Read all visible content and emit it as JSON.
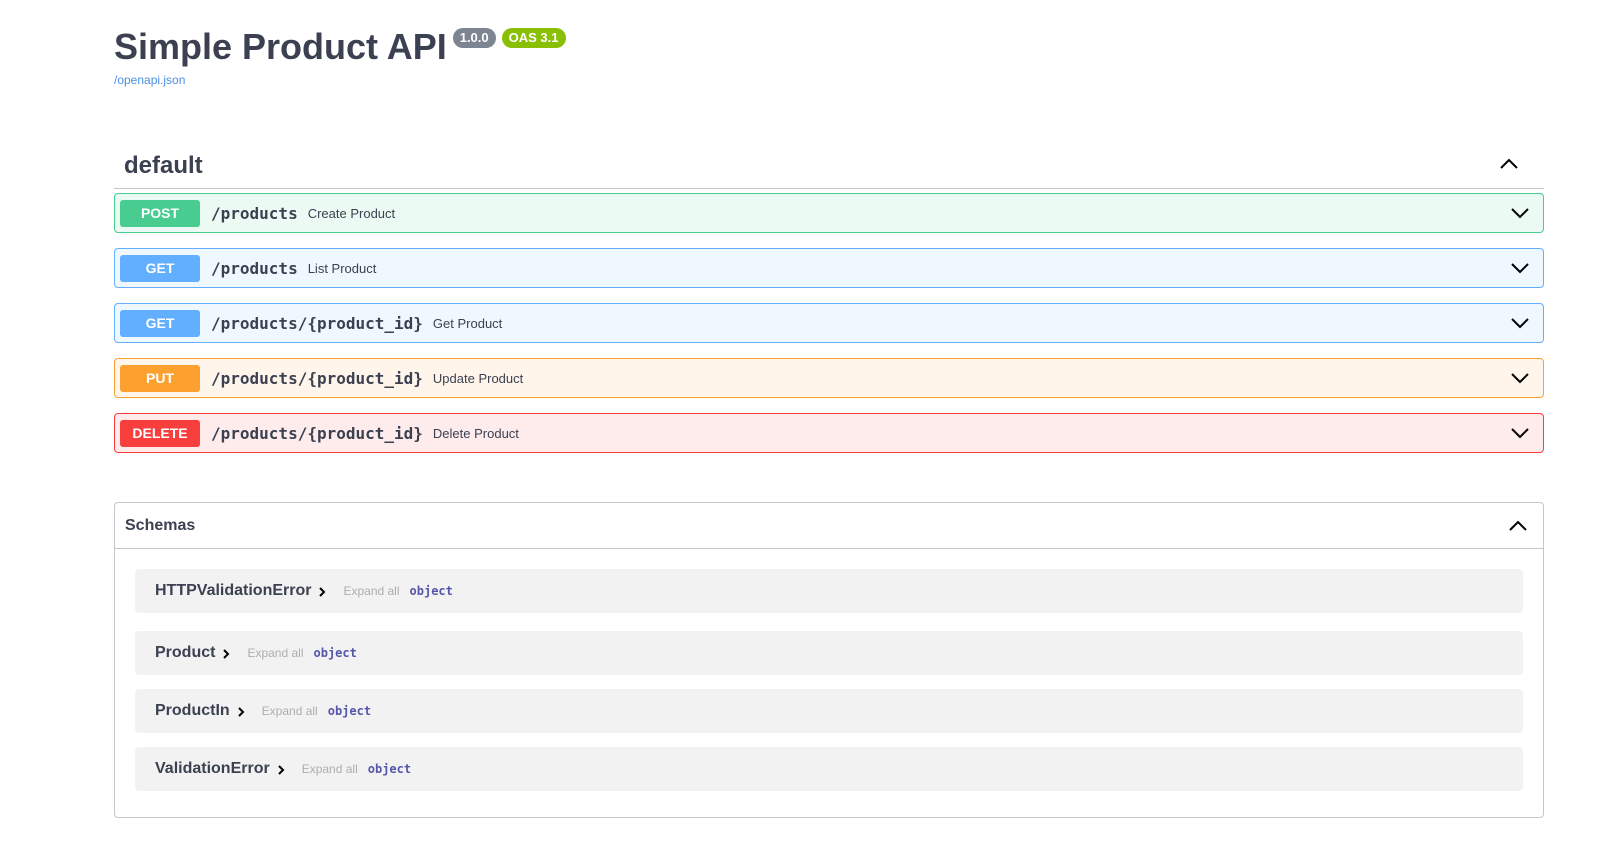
{
  "info": {
    "title": "Simple Product API",
    "version": "1.0.0",
    "oas": "OAS 3.1",
    "spec_link": "/openapi.json"
  },
  "tag": {
    "name": "default",
    "toggle_icon": "chevron-up-icon"
  },
  "operations": [
    {
      "method": "POST",
      "path": "/products",
      "summary": "Create Product",
      "color": "#49cc90"
    },
    {
      "method": "GET",
      "path": "/products",
      "summary": "List Product",
      "color": "#61affe"
    },
    {
      "method": "GET",
      "path": "/products/{product_id}",
      "summary": "Get Product",
      "color": "#61affe"
    },
    {
      "method": "PUT",
      "path": "/products/{product_id}",
      "summary": "Update Product",
      "color": "#fca130"
    },
    {
      "method": "DELETE",
      "path": "/products/{product_id}",
      "summary": "Delete Product",
      "color": "#f93e3e"
    }
  ],
  "schemas": {
    "title": "Schemas",
    "expand_label": "Expand all",
    "items": [
      {
        "name": "HTTPValidationError",
        "type": "object"
      },
      {
        "name": "Product",
        "type": "object"
      },
      {
        "name": "ProductIn",
        "type": "object"
      },
      {
        "name": "ValidationError",
        "type": "object"
      }
    ]
  }
}
